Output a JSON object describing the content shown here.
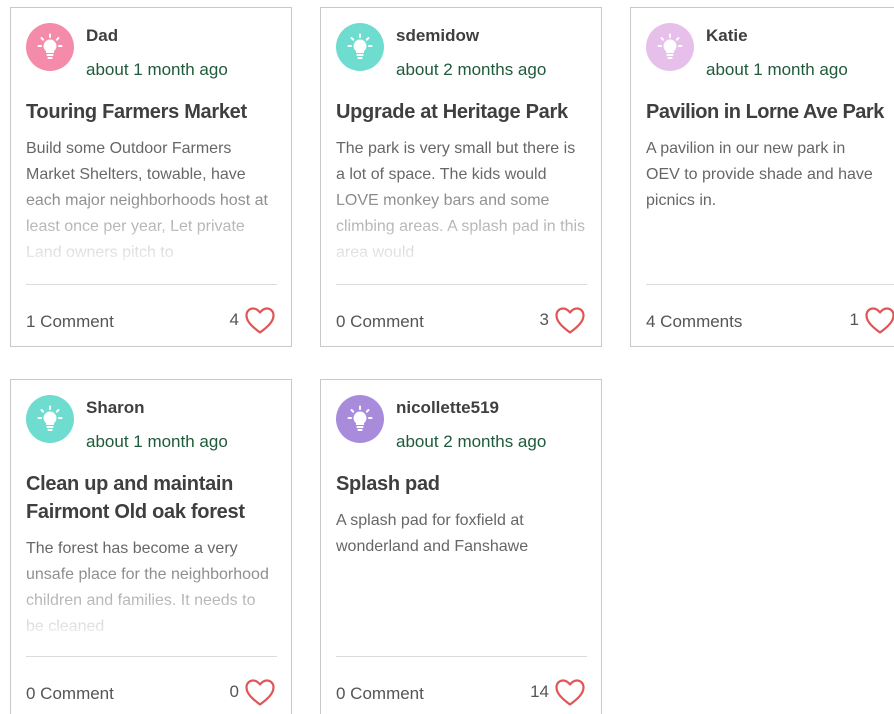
{
  "colors": {
    "heart": "#e05555",
    "time_text": "#1f5a3a"
  },
  "cards": [
    {
      "author": "Dad",
      "time": "about 1 month ago",
      "title": "Touring Farmers Market",
      "description": "Build some Outdoor Farmers Market Shelters, towable, have each major neighborhoods host at least once per year, Let private Land owners pitch to",
      "comments": "1 Comment",
      "likes": "4",
      "avatar_color": "#f48bab",
      "icon": "lightbulb-icon"
    },
    {
      "author": "sdemidow",
      "time": "about 2 months ago",
      "title": "Upgrade at Heritage Park",
      "description": "The park is very small but there is a lot of space. The kids would LOVE monkey bars and some climbing areas. A splash pad in this area would",
      "comments": "0 Comment",
      "likes": "3",
      "avatar_color": "#6fdcd0",
      "icon": "lightbulb-icon"
    },
    {
      "author": "Katie",
      "time": "about 1 month ago",
      "title": "Pavilion in Lorne Ave Park",
      "description": "A pavilion in our new park in OEV to provide shade and have picnics in.",
      "comments": "4 Comments",
      "likes": "1",
      "avatar_color": "#e6c0ea",
      "icon": "lightbulb-icon"
    },
    {
      "author": "Sharon",
      "time": "about 1 month ago",
      "title": "Clean up and maintain Fairmont Old oak forest",
      "description": "The forest has become a very unsafe place for the neighborhood children and families. It needs to be cleaned",
      "comments": "0 Comment",
      "likes": "0",
      "avatar_color": "#6fdcd0",
      "icon": "lightbulb-icon"
    },
    {
      "author": "nicollette519",
      "time": "about 2 months ago",
      "title": "Splash pad",
      "description": "A splash pad for foxfield at wonderland and Fanshawe",
      "comments": "0 Comment",
      "likes": "14",
      "avatar_color": "#a98bdc",
      "icon": "lightbulb-icon"
    }
  ]
}
